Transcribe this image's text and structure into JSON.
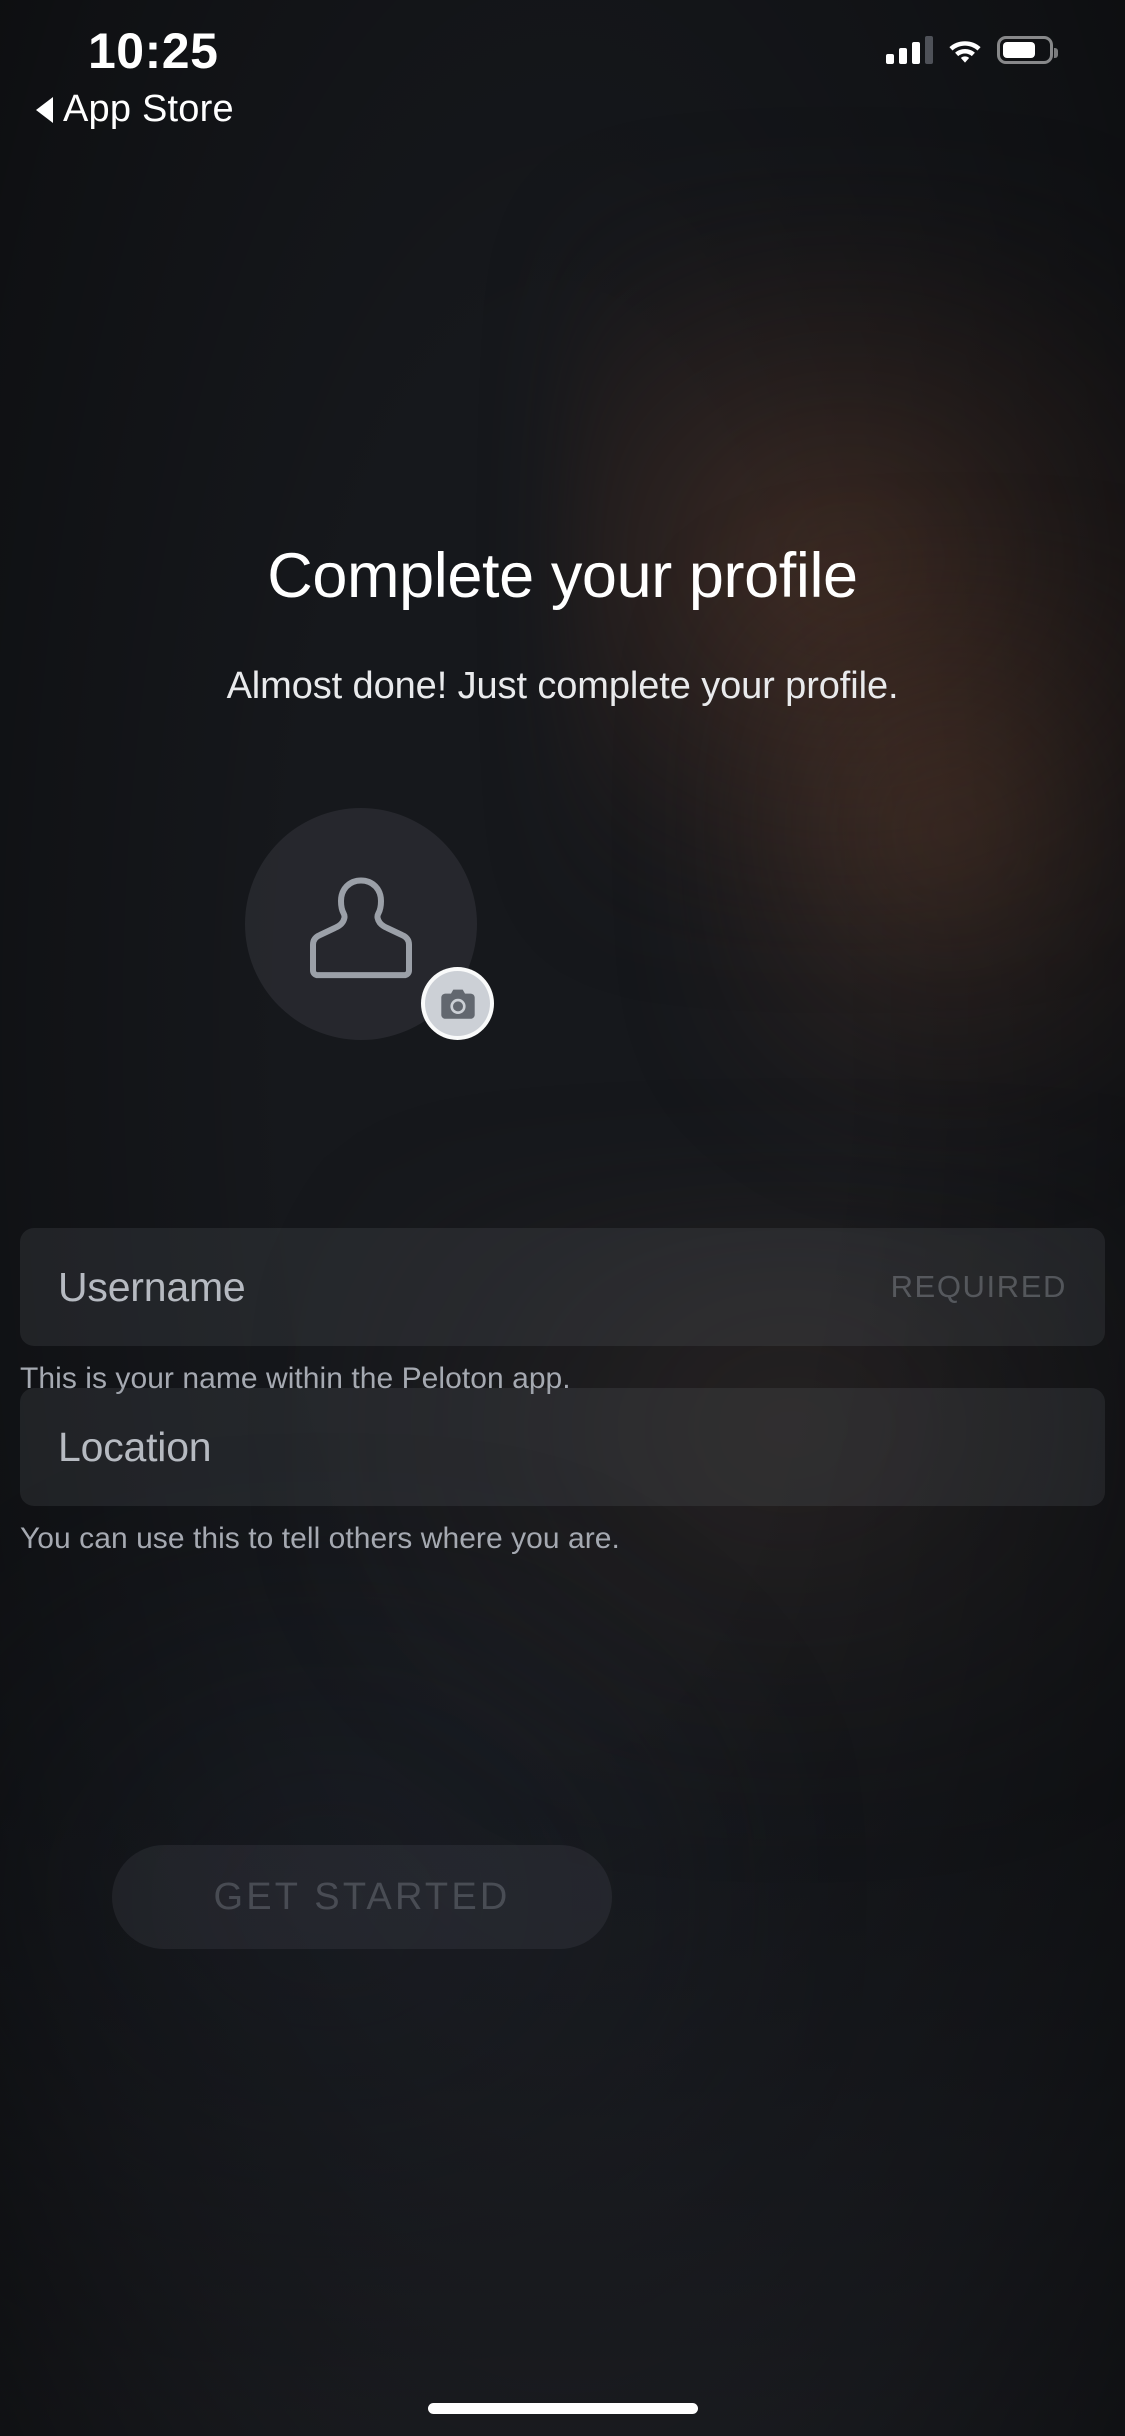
{
  "status_bar": {
    "time": "10:25",
    "cellular_icon": "cellular-signal-icon",
    "cellular_bars_filled": 3,
    "cellular_bars_total": 4,
    "wifi_icon": "wifi-icon",
    "battery_icon": "battery-icon",
    "battery_level_pct": 72
  },
  "back_link": {
    "icon": "back-triangle-icon",
    "label": "App Store"
  },
  "main": {
    "title": "Complete your profile",
    "subtitle": "Almost done! Just complete your profile.",
    "avatar": {
      "person_icon": "person-silhouette-icon",
      "camera_badge_icon": "camera-icon"
    },
    "fields": [
      {
        "name": "username",
        "placeholder": "Username",
        "value": "",
        "badge": "REQUIRED",
        "hint": "This is your name within the Peloton app."
      },
      {
        "name": "location",
        "placeholder": "Location",
        "value": "",
        "badge": "",
        "hint": "You can use this to tell others where you are."
      }
    ],
    "cta": {
      "label": "GET STARTED",
      "enabled": false
    }
  },
  "colors": {
    "background": "#16181c",
    "field_fill": "#2e2f35",
    "text_primary": "#ffffff",
    "text_secondary": "#b6bac1",
    "text_muted": "#a5a9b1",
    "camera_badge": "#ccd0d6",
    "disabled_text": "#4a4d55"
  }
}
